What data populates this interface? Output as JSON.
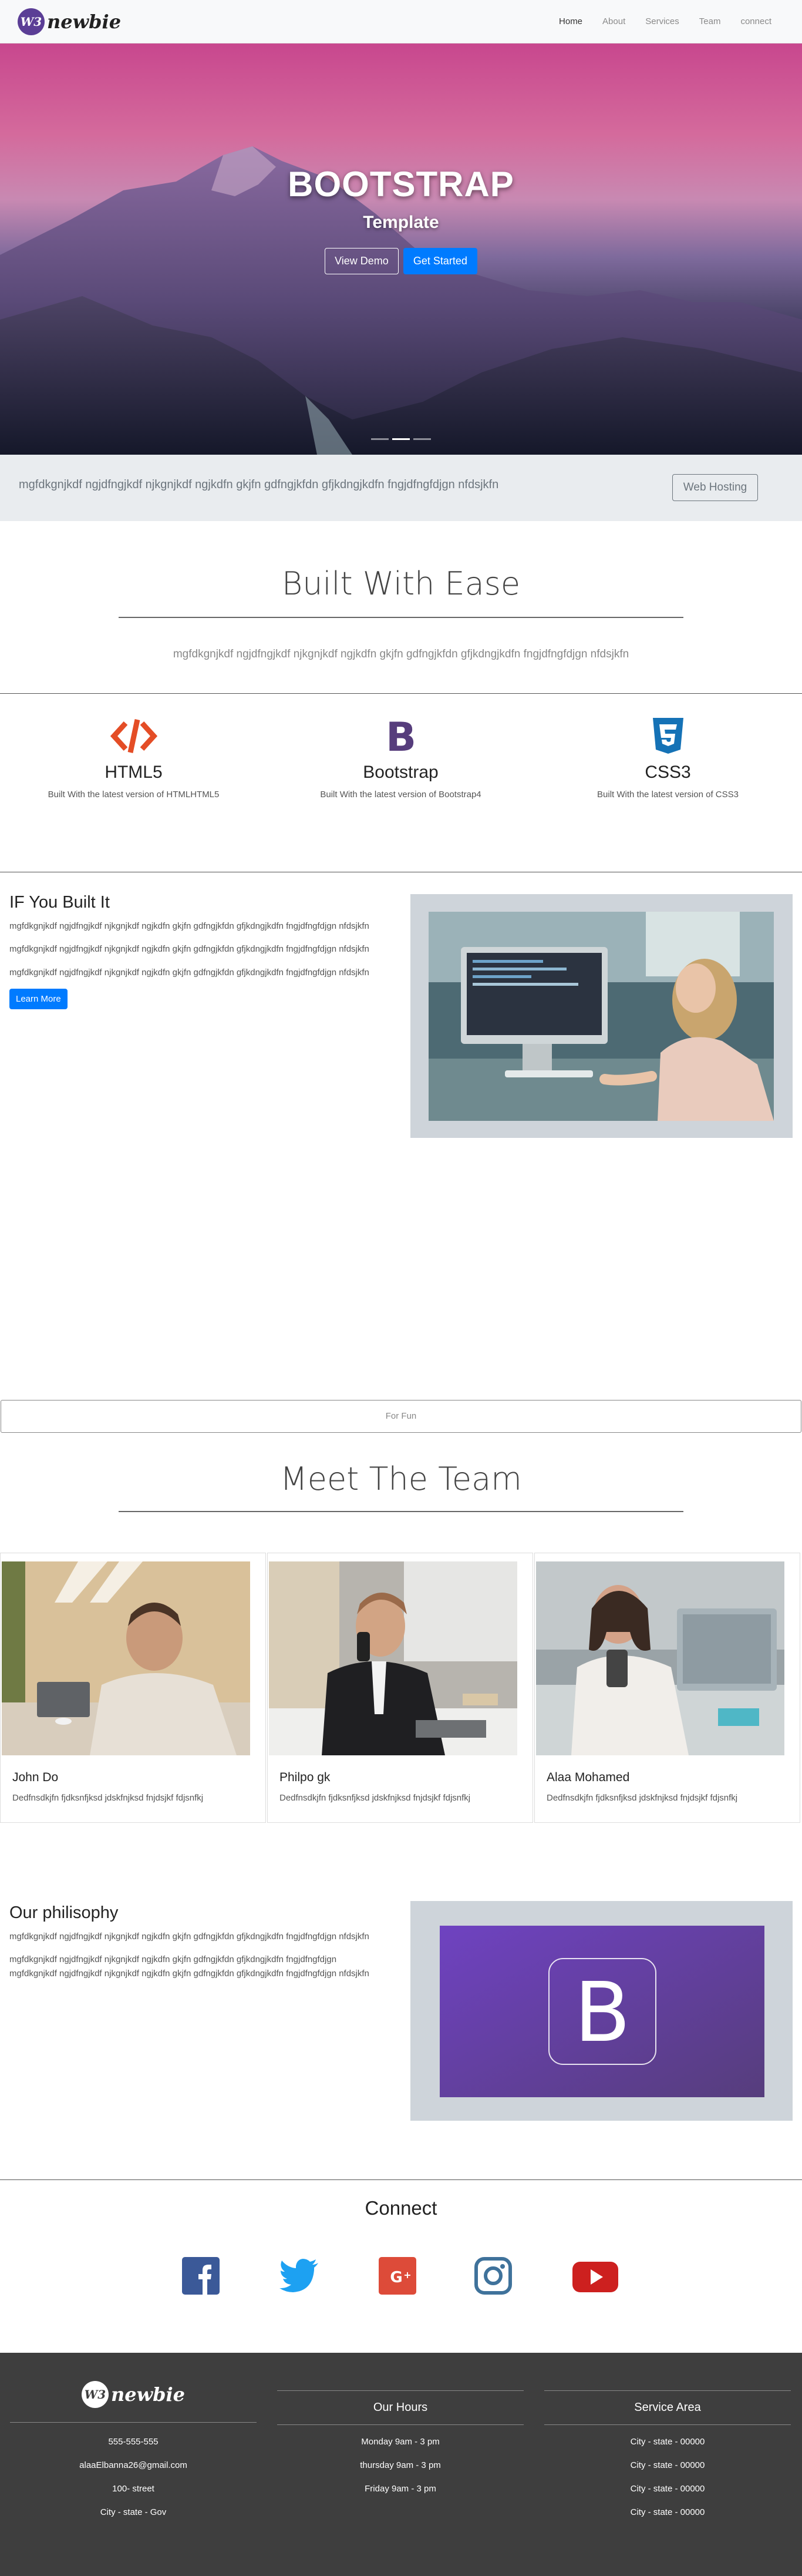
{
  "nav": {
    "brand_badge": "W3",
    "brand": "newbie",
    "items": [
      {
        "label": "Home",
        "active": true
      },
      {
        "label": "About",
        "active": false
      },
      {
        "label": "Services",
        "active": false
      },
      {
        "label": "Team",
        "active": false
      },
      {
        "label": "connect",
        "active": false
      }
    ]
  },
  "hero": {
    "title": "BOOTSTRAP",
    "subtitle": "Template",
    "demo_button": "View Demo",
    "start_button": "Get Started",
    "slides": 3,
    "active_slide": 2
  },
  "strip": {
    "text": "mgfdkgnjkdf ngjdfngjkdf njkgnjkdf ngjkdfn gkjfn gdfngjkfdn gfjkdngjkdfn fngjdfngfdjgn nfdsjkfn",
    "button": "Web Hosting"
  },
  "built_with_ease": {
    "title": "Built With Ease",
    "lead": "mgfdkgnjkdf ngjdfngjkdf njkgnjkdf ngjkdfn gkjfn gdfngjkfdn gfjkdngjkdfn fngjdfngfdjgn nfdsjkfn"
  },
  "features": [
    {
      "icon": "html5-icon",
      "title": "HTML5",
      "text": "Built With the latest version of HTMLHTML5",
      "color": "#e44d26"
    },
    {
      "icon": "bootstrap-icon",
      "title": "Bootstrap",
      "text": "Built With the latest version of Bootstrap4",
      "color": "#563d7c"
    },
    {
      "icon": "css3-icon",
      "title": "CSS3",
      "text": "Built With the latest version of CSS3",
      "color": "#1572b6"
    }
  ],
  "built_it": {
    "title": "IF You Built It",
    "paragraphs": [
      "mgfdkgnjkdf ngjdfngjkdf njkgnjkdf ngjkdfn gkjfn gdfngjkfdn gfjkdngjkdfn fngjdfngfdjgn nfdsjkfn",
      "mgfdkgnjkdf ngjdfngjkdf njkgnjkdf ngjkdfn gkjfn gdfngjkfdn gfjkdngjkdfn fngjdfngfdjgn nfdsjkfn",
      "mgfdkgnjkdf ngjdfngjkdf njkgnjkdf ngjkdfn gkjfn gdfngjkfdn gfjkdngjkdfn fngjdfngfdjgn nfdsjkfn"
    ],
    "button": "Learn More"
  },
  "for_fun": "For Fun",
  "team": {
    "title": "Meet The Team",
    "members": [
      {
        "name": "John Do",
        "bio": "Dedfnsdkjfn fjdksnfjksd jdskfnjksd fnjdsjkf fdjsnfkj"
      },
      {
        "name": "Philpo gk",
        "bio": "Dedfnsdkjfn fjdksnfjksd jdskfnjksd fnjdsjkf fdjsnfkj"
      },
      {
        "name": "Alaa Mohamed",
        "bio": "Dedfnsdkjfn fjdksnfjksd jdskfnjksd fnjdsjkf fdjsnfkj"
      }
    ]
  },
  "philosophy": {
    "title": "Our philisophy",
    "paragraphs": [
      "mgfdkgnjkdf ngjdfngjkdf njkgnjkdf ngjkdfn gkjfn gdfngjkfdn gfjkdngjkdfn fngjdfngfdjgn nfdsjkfn",
      "mgfdkgnjkdf ngjdfngjkdf njkgnjkdf ngjkdfn gkjfn gdfngjkfdn gfjkdngjkdfn fngjdfngfdjgn mgfdkgnjkdf ngjdfngjkdf njkgnjkdf ngjkdfn gkjfn gdfngjkfdn gfjkdngjkdfn fngjdfngfdjgn nfdsjkfn"
    ],
    "logo_letter": "B"
  },
  "connect": {
    "title": "Connect",
    "networks": [
      {
        "icon": "facebook-icon",
        "color": "#3b5998"
      },
      {
        "icon": "twitter-icon",
        "color": "#1da1f2"
      },
      {
        "icon": "google-plus-icon",
        "color": "#dd4b39"
      },
      {
        "icon": "instagram-icon",
        "color": "#3f729b"
      },
      {
        "icon": "youtube-icon",
        "color": "#cd201f"
      }
    ]
  },
  "footer": {
    "brand_badge": "W3",
    "brand": "newbie",
    "contact": [
      "555-555-555",
      "alaaElbanna26@gmail.com",
      "100- street",
      "City - state - Gov"
    ],
    "hours_title": "Our Hours",
    "hours": [
      "Monday 9am - 3 pm",
      "thursday 9am - 3 pm",
      "Friday 9am - 3 pm"
    ],
    "service_title": "Service Area",
    "service": [
      "City - state - 00000",
      "City - state - 00000",
      "City - state - 00000",
      "City - state - 00000"
    ]
  }
}
